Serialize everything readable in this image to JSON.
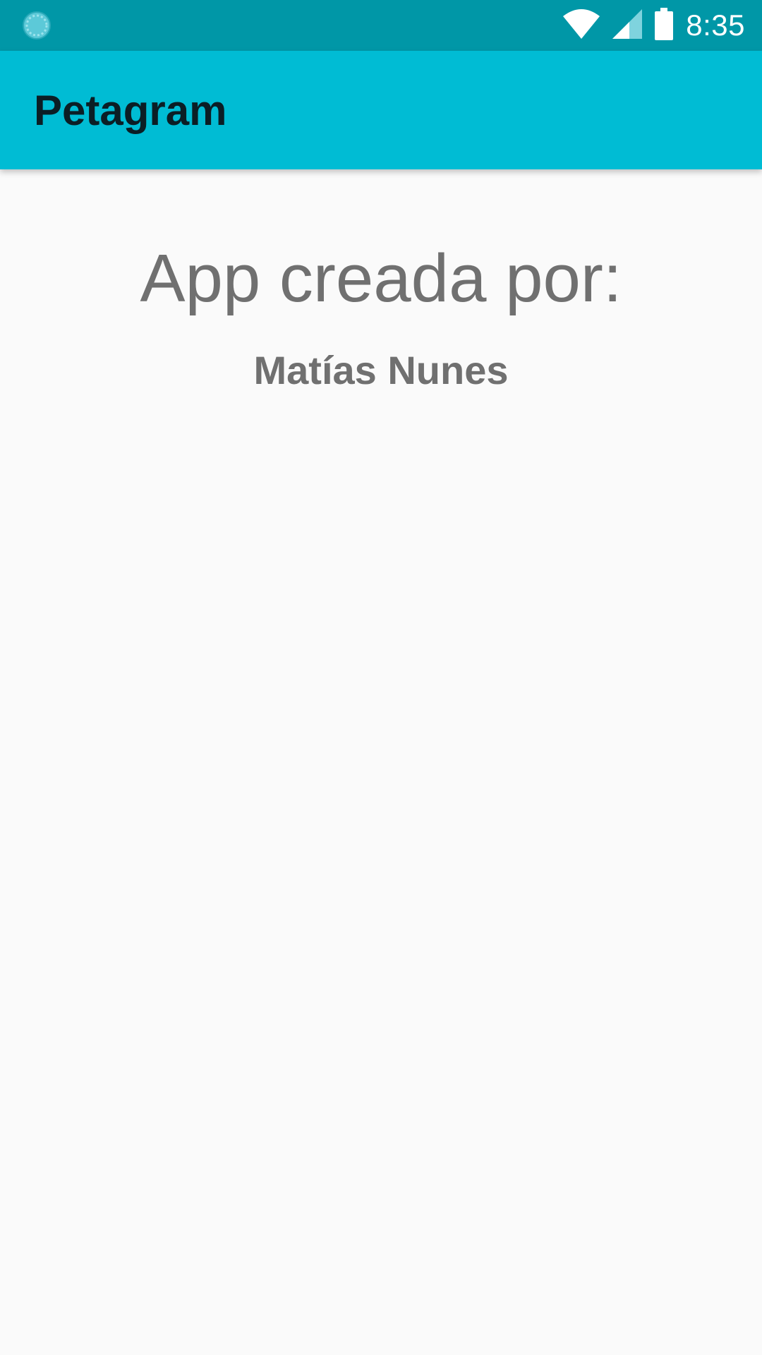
{
  "status_bar": {
    "time": "8:35",
    "icons": [
      "sync-icon",
      "wifi-icon",
      "signal-icon",
      "battery-icon"
    ],
    "background_color": "#0097a7"
  },
  "app_bar": {
    "title": "Petagram",
    "background_color": "#00bcd4"
  },
  "content": {
    "heading": "App creada por:",
    "author": "Matías Nunes",
    "text_color": "#707070"
  }
}
